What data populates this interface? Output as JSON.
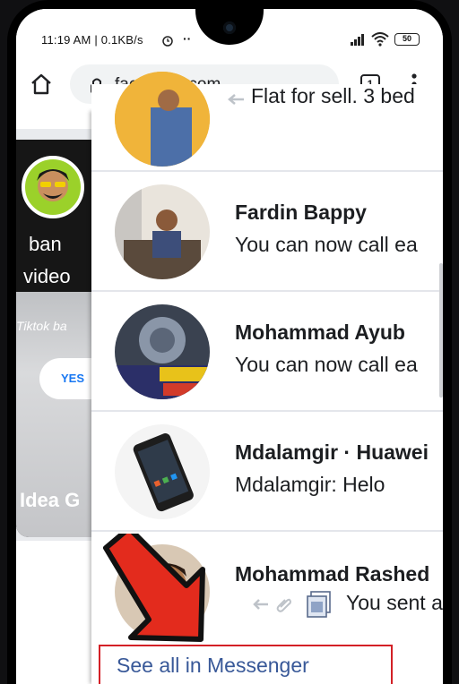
{
  "status_bar": {
    "time": "11:19 AM | 0.1KB/s",
    "more": "··",
    "battery": "50"
  },
  "browser": {
    "url": "facebook.com",
    "tab_count": "1"
  },
  "background_story": {
    "line1": "ban",
    "line2": "video",
    "line3": "Tiktok ba",
    "button": "YES",
    "title": "Idea G"
  },
  "messages": [
    {
      "name": "",
      "snippet": "Flat for sell. 3 bed"
    },
    {
      "name": "Fardin Bappy",
      "snippet": "You can now call ea"
    },
    {
      "name": "Mohammad Ayub",
      "snippet": "You can now call ea"
    },
    {
      "name": "Mdalamgir · Huawei",
      "snippet": "Mdalamgir: Helo"
    },
    {
      "name": "Mohammad Rashed",
      "snippet": "You sent a"
    }
  ],
  "see_all_label": "See all in Messenger",
  "colors": {
    "accent_red": "#e32b1d",
    "link_blue": "#385898",
    "facebook_blue": "#1877f2"
  },
  "icons": [
    "home-icon",
    "lock-icon",
    "tabs-icon",
    "more-vert-icon",
    "reply-icon",
    "attachment-icon",
    "image-icon",
    "signal-icon",
    "wifi-icon",
    "alarm-icon"
  ]
}
